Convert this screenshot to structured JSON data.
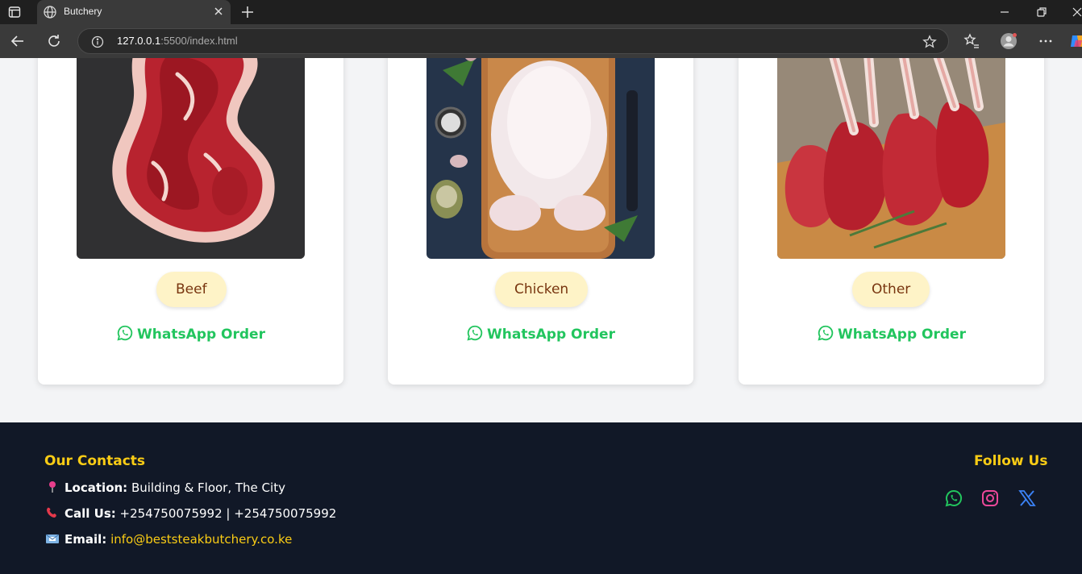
{
  "browser": {
    "tab_title": "Butchery",
    "url_host": "127.0.0.1",
    "url_path": ":5500/index.html"
  },
  "cards": [
    {
      "name": "Beef",
      "order_label": "WhatsApp Order",
      "image_icon": "beef-steak-photo"
    },
    {
      "name": "Chicken",
      "order_label": "WhatsApp Order",
      "image_icon": "whole-chicken-photo"
    },
    {
      "name": "Other",
      "order_label": "WhatsApp Order",
      "image_icon": "lamb-chops-photo"
    }
  ],
  "footer": {
    "contacts_heading": "Our Contacts",
    "location_label": "Location:",
    "location_value": "Building & Floor, The City",
    "call_label": "Call Us:",
    "call_value": "+254750075992 | +254750075992",
    "email_label": "Email:",
    "email_value": "info@beststeakbutchery.co.ke",
    "follow_heading": "Follow Us",
    "social_icons": [
      "whatsapp-icon",
      "instagram-icon",
      "x-icon"
    ]
  },
  "colors": {
    "accent": "#facc15",
    "whatsapp": "#22c55e",
    "footer_bg": "#111827",
    "pill_bg": "#fef3c7",
    "pill_text": "#78350f"
  }
}
